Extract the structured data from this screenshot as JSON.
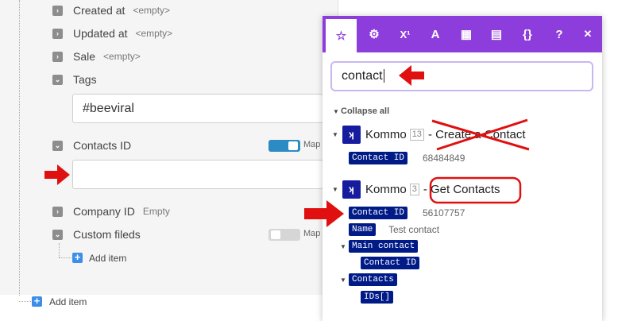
{
  "fields": {
    "created_at": {
      "label": "Created at",
      "hint": "<empty>"
    },
    "updated_at": {
      "label": "Updated at",
      "hint": "<empty>"
    },
    "sale": {
      "label": "Sale",
      "hint": "<empty>"
    },
    "tags": {
      "label": "Tags",
      "value": "#beeviral"
    },
    "contacts_id": {
      "label": "Contacts ID",
      "value": ""
    },
    "company_id": {
      "label": "Company ID",
      "hint": "Empty"
    },
    "custom_fields": {
      "label": "Custom fileds"
    }
  },
  "map_label": "Map",
  "add_item_label": "Add item",
  "popup": {
    "tabs": [
      {
        "icon": "star-icon",
        "glyph": "☆"
      },
      {
        "icon": "gear-icon",
        "glyph": "⚙"
      },
      {
        "icon": "superscript-icon",
        "glyph": "X¹"
      },
      {
        "icon": "text-icon",
        "glyph": "A"
      },
      {
        "icon": "calendar-icon",
        "glyph": "▦"
      },
      {
        "icon": "table-icon",
        "glyph": "▤"
      },
      {
        "icon": "braces-icon",
        "glyph": "{}"
      },
      {
        "icon": "help-icon",
        "glyph": "?"
      },
      {
        "icon": "close-icon",
        "glyph": "✕"
      }
    ],
    "search_value": "contact",
    "collapse_all": "Collapse all",
    "modules": [
      {
        "name": "Kommo",
        "num": "13",
        "desc": "- Create a Contact",
        "items": [
          {
            "label": "Contact ID",
            "value": "68484849"
          }
        ]
      },
      {
        "name": "Kommo",
        "num": "3",
        "desc": "- Get Contacts",
        "items": [
          {
            "label": "Contact ID",
            "value": "56107757"
          },
          {
            "label": "Name",
            "value": "Test contact"
          },
          {
            "label": "Main contact"
          },
          {
            "label": "Contact ID"
          },
          {
            "label": "Contacts"
          },
          {
            "label": "IDs[]"
          }
        ]
      }
    ]
  },
  "colors": {
    "accent": "#8d3ddb",
    "pill": "#001a88",
    "kommo": "#171b9e",
    "annotation": "#e01010"
  }
}
